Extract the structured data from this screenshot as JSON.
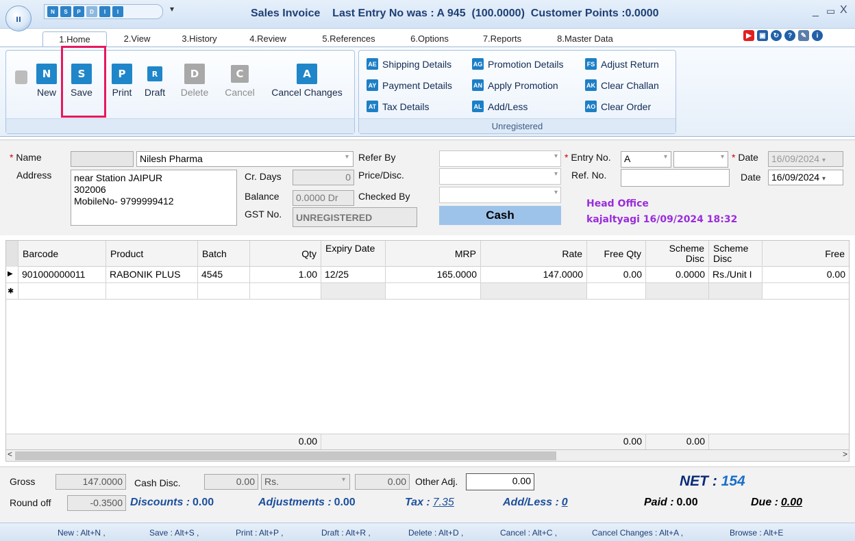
{
  "window": {
    "title": "Sales Invoice",
    "last_entry": "Last Entry No was : A 945",
    "points_value": "(100.0000)",
    "customer_points": "Customer Points :0.0000",
    "min": "_",
    "max": "▭",
    "close": "X",
    "qat_menu": "▾"
  },
  "qat": [
    "N",
    "S",
    "P",
    "D",
    "I",
    "I"
  ],
  "tabs": [
    "1.Home",
    "2.View",
    "3.History",
    "4.Review",
    "5.References",
    "6.Options",
    "7.Reports",
    "8.Master Data"
  ],
  "ribbon_buttons": [
    {
      "label": "New",
      "icon": "N"
    },
    {
      "label": "Save",
      "icon": "S"
    },
    {
      "label": "Print",
      "icon": "P"
    },
    {
      "label": "Draft",
      "icon": "R"
    },
    {
      "label": "Delete",
      "icon": "D"
    },
    {
      "label": "Cancel",
      "icon": "C"
    },
    {
      "label": "Cancel Changes",
      "icon": "A"
    }
  ],
  "ribbon_links": [
    {
      "label": "Shipping Details",
      "icon": "AE"
    },
    {
      "label": "Promotion Details",
      "icon": "AG"
    },
    {
      "label": "Adjust Return",
      "icon": "FS"
    },
    {
      "label": "Payment Details",
      "icon": "AY"
    },
    {
      "label": "Apply Promotion",
      "icon": "AN"
    },
    {
      "label": "Clear Challan",
      "icon": "AK"
    },
    {
      "label": "Tax Details",
      "icon": "AT"
    },
    {
      "label": "Add/Less",
      "icon": "AL"
    },
    {
      "label": "Clear Order",
      "icon": "AO"
    }
  ],
  "ribbon_group_label": "Unregistered",
  "form": {
    "name_label": "Name",
    "name_value": "Nilesh Pharma",
    "address_label": "Address",
    "address_lines": [
      "near Station JAIPUR",
      "302006",
      "MobileNo- 9799999412"
    ],
    "cr_days_label": "Cr. Days",
    "cr_days_value": "0",
    "balance_label": "Balance",
    "balance_value": "0.0000 Dr",
    "gst_label": "GST No.",
    "gst_value": "UNREGISTERED",
    "refer_by_label": "Refer By",
    "price_disc_label": "Price/Disc.",
    "checked_by_label": "Checked By",
    "cash_label": "Cash",
    "entry_no_label": "Entry No.",
    "entry_series": "A",
    "ref_no_label": "Ref. No.",
    "date_label": "Date",
    "date_value_1": "16/09/2024",
    "date_value_2": "16/09/2024",
    "head_office": "Head Office",
    "user_stamp": "kajaltyagi 16/09/2024 18:32"
  },
  "grid": {
    "columns": [
      "Barcode",
      "Product",
      "Batch",
      "Qty",
      "Expiry Date",
      "MRP",
      "Rate",
      "Free Qty",
      "Scheme Disc",
      "Scheme Disc",
      "Free"
    ],
    "row": {
      "barcode": "901000000011",
      "product": "RABONIK PLUS",
      "batch": "4545",
      "qty": "1.00",
      "expiry": "12/25",
      "mrp": "165.0000",
      "rate": "147.0000",
      "free_qty": "0.00",
      "scheme_disc": "0.0000",
      "scheme_type": "Rs./Unit I",
      "free": "0.00"
    },
    "totals": {
      "qty": "0.00",
      "free_qty": "0.00",
      "scheme_disc": "0.00"
    },
    "row_marker": "▶",
    "new_marker": "✱"
  },
  "bottom": {
    "gross_label": "Gross",
    "gross_value": "147.0000",
    "cash_disc_label": "Cash Disc.",
    "cash_disc_value": "0.00",
    "cash_disc_unit": "Rs.",
    "cash_disc_amount": "0.00",
    "other_adj_label": "Other Adj.",
    "other_adj_value": "0.00",
    "round_off_label": "Round off",
    "round_off_value": "-0.3500",
    "discounts_label": "Discounts :",
    "discounts_value": "0.00",
    "adjustments_label": "Adjustments :",
    "adjustments_value": "0.00",
    "tax_label": "Tax :",
    "tax_value": "7.35",
    "addless_label": "Add/Less :",
    "addless_value": "0",
    "net_label": "NET :",
    "net_value": "154",
    "paid_label": "Paid :",
    "paid_value": "0.00",
    "due_label": "Due :",
    "due_value": "0.00"
  },
  "shortcuts": [
    "New : Alt+N ,",
    "Save : Alt+S ,",
    "Print : Alt+P ,",
    "Draft : Alt+R ,",
    "Delete : Alt+D ,",
    "Cancel : Alt+C ,",
    "Cancel Changes : Alt+A ,",
    "Browse : Alt+E"
  ]
}
